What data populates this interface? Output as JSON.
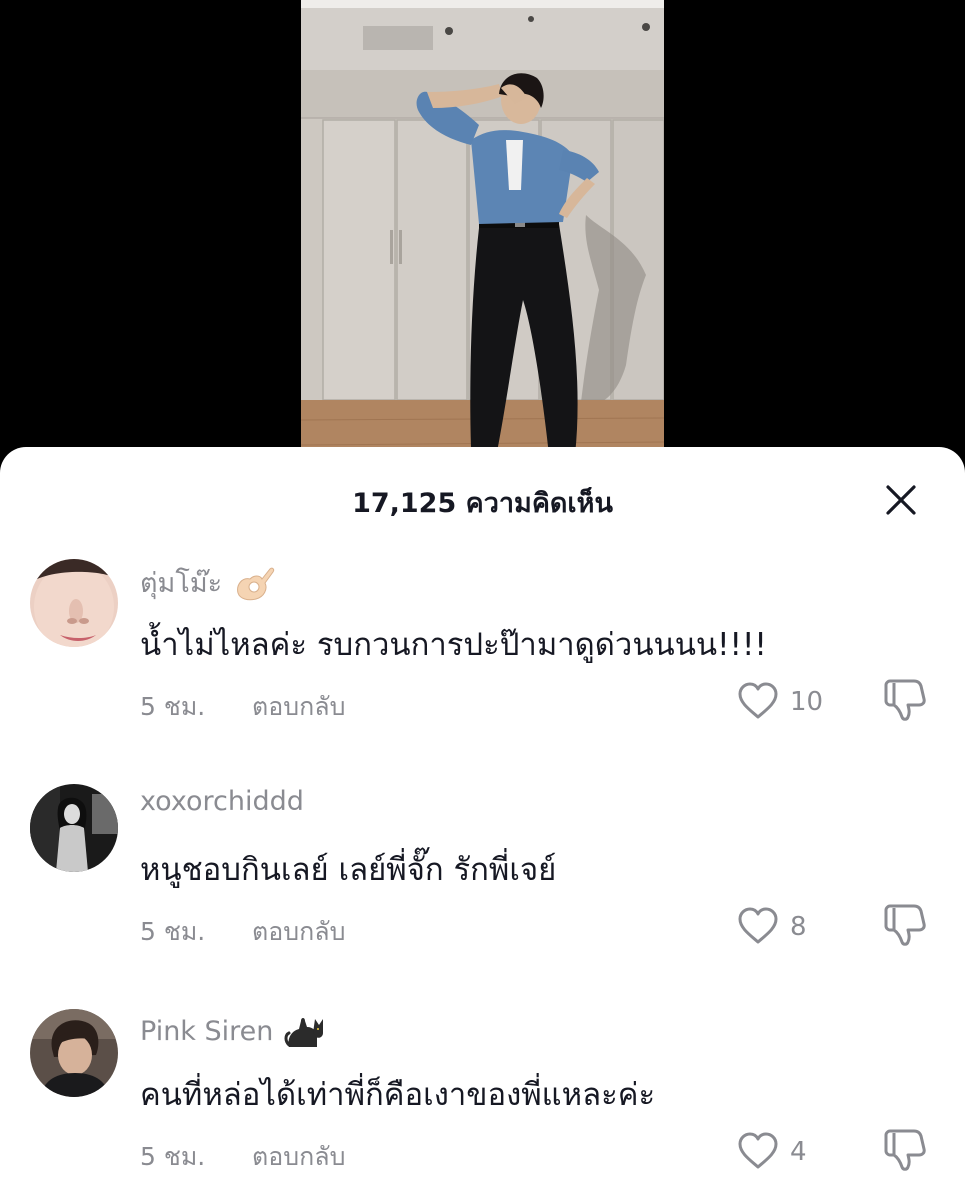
{
  "header": {
    "title": "17,125 ความคิดเห็น",
    "close_icon": "close-icon"
  },
  "comments": [
    {
      "username": "ตุ่มโม๊ะ",
      "emoji": "ok-hand-emoji",
      "text": "น้ำไม่ไหลค่ะ รบกวนการปะป๊ามาดูด่วนนนน!!!!",
      "time": "5 ชม.",
      "reply_label": "ตอบกลับ",
      "likes": "10"
    },
    {
      "username": "xoxorchiddd",
      "text": "หนูชอบกินเลย์ เลย์พี่จั๊ก รักพี่เจย์",
      "time": "5 ชม.",
      "reply_label": "ตอบกลับ",
      "likes": "8"
    },
    {
      "username": "Pink Siren",
      "emoji": "black-cat-emoji",
      "text": "คนที่หล่อได้เท่าพี่ก็คือเงาของพี่แหละค่ะ",
      "time": "5 ชม.",
      "reply_label": "ตอบกลับ",
      "likes": "4"
    }
  ],
  "colors": {
    "primary_text": "#161823",
    "secondary_text": "#8a8b91",
    "sheet_bg": "#ffffff",
    "backdrop": "#000000"
  }
}
